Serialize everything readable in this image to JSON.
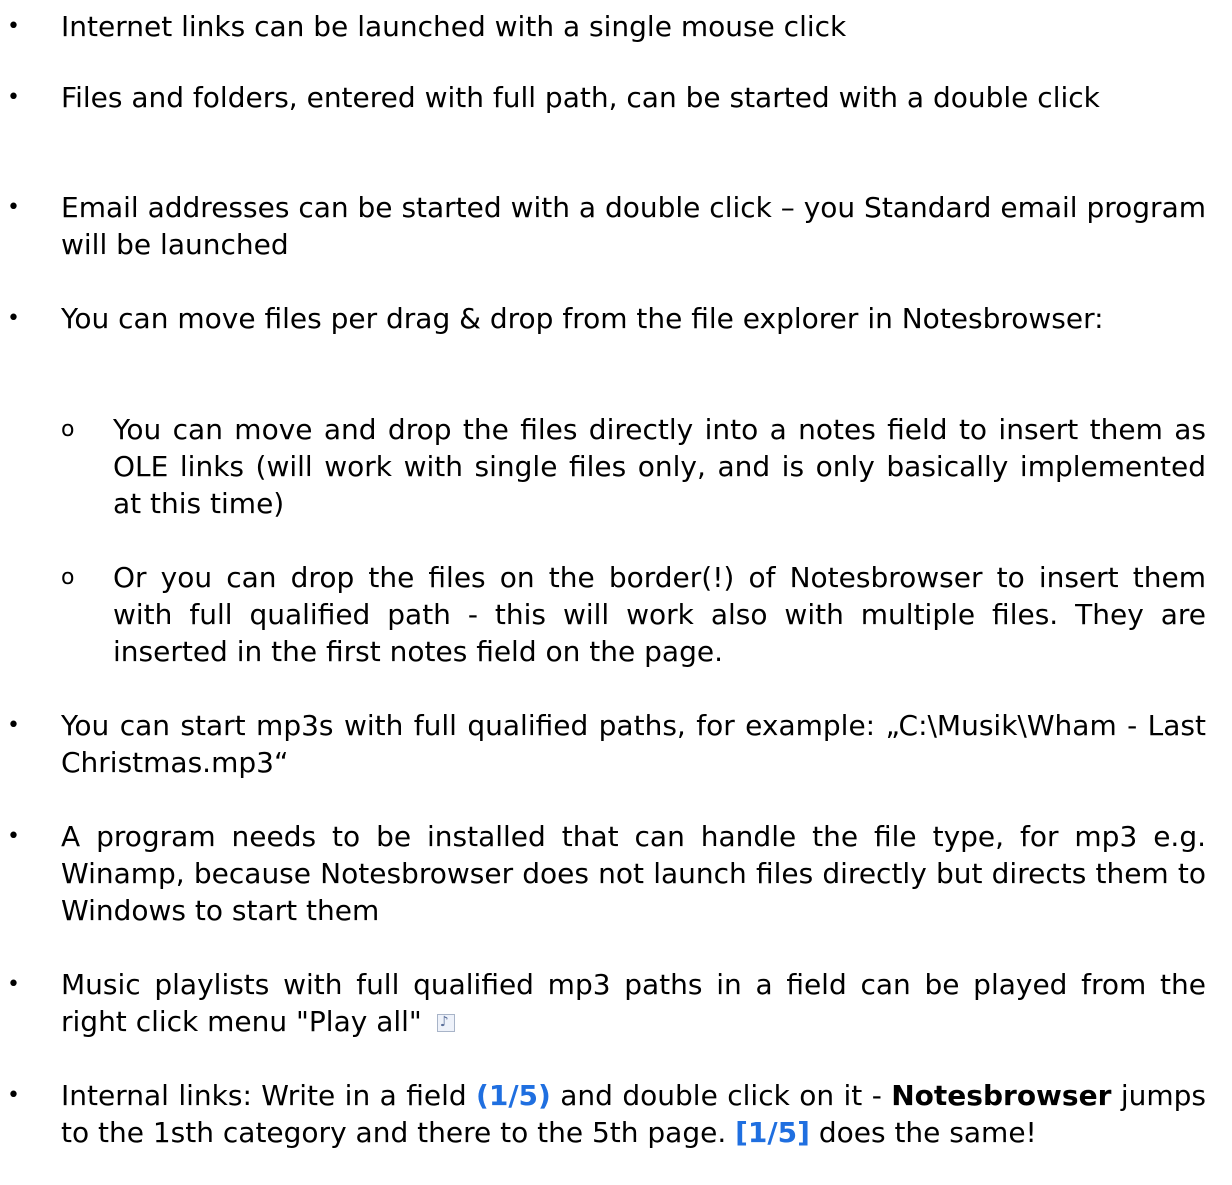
{
  "bullets": [
    "Internet links can be launched with a single mouse click",
    "Files and folders, entered with full path, can be started with a double click",
    "Email addresses can be started with a double click – you Standard email program will be launched",
    "You can move files per drag & drop from the file explorer in Notesbrowser:"
  ],
  "sub_bullets": [
    "You can move and drop the files directly into a notes field to insert them as OLE links (will work with single files only, and is only basically implemented at this time)",
    "Or you can drop the files on the border(!) of Notesbrowser to insert them with full qualified path - this will work also with multiple files. They are inserted in the first notes field on the page."
  ],
  "more_bullets": [
    "You can start mp3s with full qualified paths, for example: „C:\\Musik\\Wham - Last Christmas.mp3“",
    "A program needs to be installed that can handle the file type, for mp3 e.g. Winamp, because Notesbrowser does not launch files directly but directs them to Windows to start them",
    "Music playlists with full qualified mp3 paths in a field can be played from the right click menu \"Play all\""
  ],
  "last_bullet": {
    "part1": "Internal links: Write in a field ",
    "link1": "(1/5)",
    "part2": " and double click on it - ",
    "bold": "Notesbrowser",
    "part3": " jumps to the 1sth category and there to the 5th page. ",
    "link2": "[1/5]",
    "part4": " does the same!"
  },
  "icons": {
    "music": "music-note-icon"
  },
  "colors": {
    "link_blue": "#1f6fe0"
  }
}
